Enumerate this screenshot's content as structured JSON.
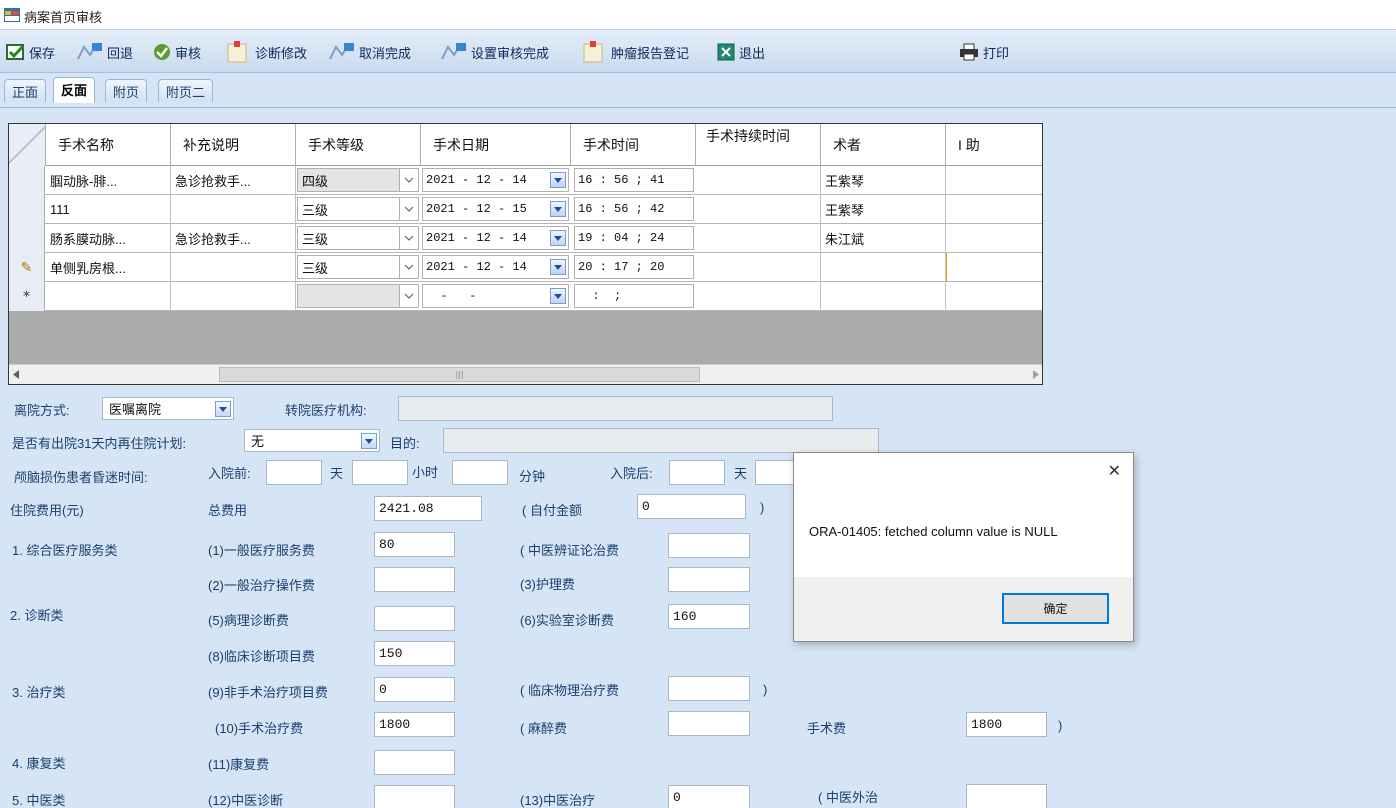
{
  "window": {
    "title": "病案首页审核"
  },
  "toolbar": {
    "save": "保存",
    "rollback": "回退",
    "audit": "审核",
    "diag_edit": "诊断修改",
    "cancel_complete": "取消完成",
    "set_audit_complete": "设置审核完成",
    "tumor_report": "肿瘤报告登记",
    "exit": "退出",
    "print": "打印"
  },
  "tabs": [
    "正面",
    "反面",
    "附页",
    "附页二"
  ],
  "active_tab": "反面",
  "grid": {
    "headers": [
      "手术名称",
      "补充说明",
      "手术等级",
      "手术日期",
      "手术时间",
      "手术持续时间",
      "术者",
      "I 助"
    ],
    "rows": [
      {
        "marker": "",
        "name": "腘动脉-腓...",
        "note": "急诊抢救手...",
        "level": "四级",
        "date": "2021 - 12 - 14",
        "time": "16 : 56 ; 41",
        "duration": "",
        "surgeon": "王紫琴",
        "assist": ""
      },
      {
        "marker": "",
        "name": "111",
        "note": "",
        "level": "三级",
        "date": "2021 - 12 - 15",
        "time": "16 : 56 ; 42",
        "duration": "",
        "surgeon": "王紫琴",
        "assist": ""
      },
      {
        "marker": "",
        "name": "肠系膜动脉...",
        "note": "急诊抢救手...",
        "level": "三级",
        "date": "2021 - 12 - 14",
        "time": "19 : 04 ; 24",
        "duration": "",
        "surgeon": "朱江斌",
        "assist": ""
      },
      {
        "marker": "✎",
        "name": "单侧乳房根...",
        "note": "",
        "level": "三级",
        "date": "2021 - 12 - 14",
        "time": "20 : 17 ; 20",
        "duration": "",
        "surgeon": "",
        "assist": ""
      },
      {
        "marker": "*",
        "name": "",
        "note": "",
        "level": "",
        "date": "  -   -",
        "time": "  :  ;",
        "duration": "",
        "surgeon": "",
        "assist": ""
      }
    ]
  },
  "form": {
    "discharge_label": "离院方式:",
    "discharge_value": "医嘱离院",
    "transfer_label": "转院医疗机构:",
    "readmit_label": "是否有出院31天内再住院计划:",
    "readmit_value": "无",
    "purpose_label": "目的:",
    "coma_label": "颅脑损伤患者昏迷时间:",
    "before_label": "入院前:",
    "day": "天",
    "hour": "小时",
    "minute": "分钟",
    "after_label": "入院后:",
    "cost_label": "住院费用(元)",
    "total_label": "总费用",
    "total_value": "2421.08",
    "self_pay_label": "( 自付金额",
    "self_pay_value": "0",
    "close_paren": ")",
    "cat1": "1. 综合医疗服务类",
    "c1_label": "(1)一般医疗服务费",
    "c1_value": "80",
    "tcm_diag_label": "( 中医辨证论治费",
    "c2_label": "(2)一般治疗操作费",
    "c3_label": "(3)护理费",
    "cat2": "2. 诊断类",
    "c5_label": "(5)病理诊断费",
    "c6_label": "(6)实验室诊断费",
    "c6_value": "160",
    "c8_label": "(8)临床诊断项目费",
    "c8_value": "150",
    "cat3": "3. 治疗类",
    "c9_label": "(9)非手术治疗项目费",
    "c9_value": "0",
    "physio_label": "( 临床物理治疗费",
    "c10_label": "(10)手术治疗费",
    "c10_value": "1800",
    "anes_label": "( 麻醉费",
    "surgery_fee_label": "手术费",
    "surgery_fee_value": "1800",
    "cat4": "4. 康复类",
    "c11_label": "(11)康复费",
    "cat5": "5. 中医类",
    "c12_label": "(12)中医诊断",
    "c13_label": "(13)中医治疗",
    "c13_value": "0",
    "tcm_ext_label": "( 中医外治"
  },
  "dialog": {
    "message": "ORA-01405: fetched column value is NULL",
    "ok": "确定",
    "close": "✕"
  }
}
